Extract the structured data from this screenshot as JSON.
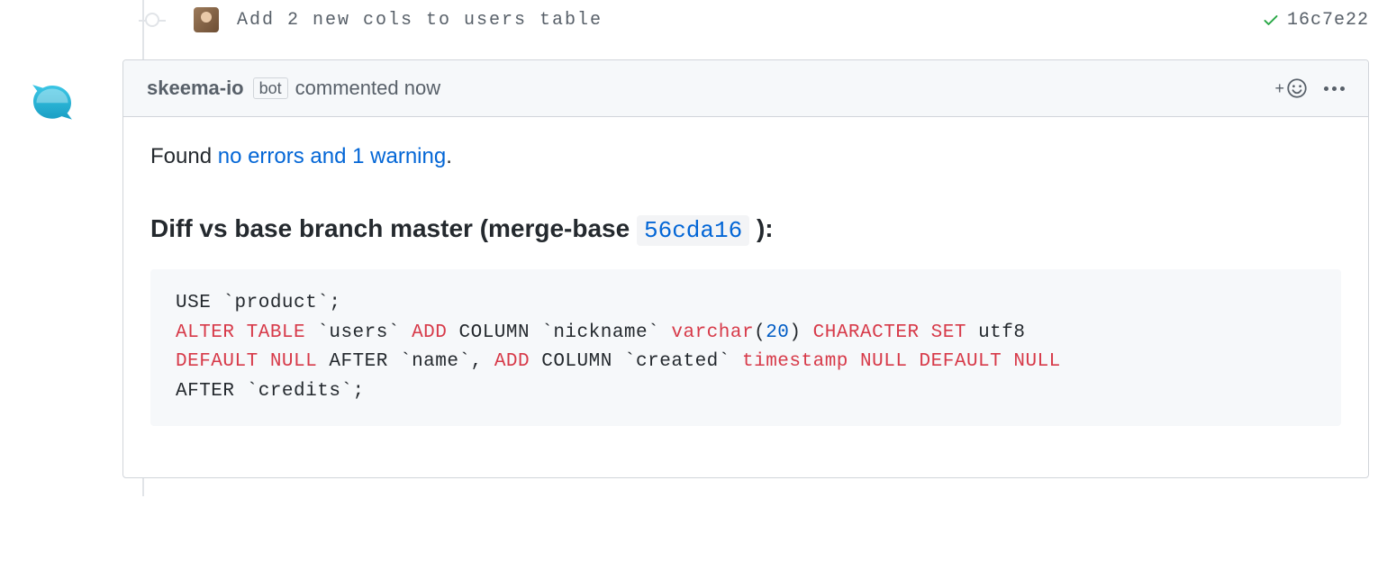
{
  "commit": {
    "message": "Add 2 new cols to users table",
    "status": "success",
    "sha": "16c7e22"
  },
  "comment": {
    "author": "skeema-io",
    "bot_label": "bot",
    "verb": "commented",
    "timestamp": "now",
    "found_prefix": "Found ",
    "found_link": "no errors and 1 warning",
    "found_suffix": ".",
    "diff": {
      "heading_pre": "Diff vs base branch master (merge-base ",
      "sha": "56cda16",
      "heading_post": " ):"
    },
    "code_tokens": [
      {
        "t": "USE "
      },
      {
        "t": "`product`"
      },
      {
        "t": ";\n"
      },
      {
        "t": "ALTER",
        "c": "kw"
      },
      {
        "t": " "
      },
      {
        "t": "TABLE",
        "c": "kw"
      },
      {
        "t": " "
      },
      {
        "t": "`users`"
      },
      {
        "t": " "
      },
      {
        "t": "ADD",
        "c": "kw"
      },
      {
        "t": " COLUMN "
      },
      {
        "t": "`nickname`"
      },
      {
        "t": " "
      },
      {
        "t": "varchar",
        "c": "kw"
      },
      {
        "t": "("
      },
      {
        "t": "20",
        "c": "num"
      },
      {
        "t": ") "
      },
      {
        "t": "CHARACTER",
        "c": "kw"
      },
      {
        "t": " "
      },
      {
        "t": "SET",
        "c": "kw"
      },
      {
        "t": " utf8\n"
      },
      {
        "t": "DEFAULT",
        "c": "kw"
      },
      {
        "t": " "
      },
      {
        "t": "NULL",
        "c": "kw"
      },
      {
        "t": " AFTER "
      },
      {
        "t": "`name`"
      },
      {
        "t": ", "
      },
      {
        "t": "ADD",
        "c": "kw"
      },
      {
        "t": " COLUMN "
      },
      {
        "t": "`created`"
      },
      {
        "t": " "
      },
      {
        "t": "timestamp",
        "c": "kw"
      },
      {
        "t": " "
      },
      {
        "t": "NULL",
        "c": "kw"
      },
      {
        "t": " "
      },
      {
        "t": "DEFAULT",
        "c": "kw"
      },
      {
        "t": " "
      },
      {
        "t": "NULL",
        "c": "kw"
      },
      {
        "t": "\n"
      },
      {
        "t": "AFTER "
      },
      {
        "t": "`credits`"
      },
      {
        "t": ";"
      }
    ]
  }
}
